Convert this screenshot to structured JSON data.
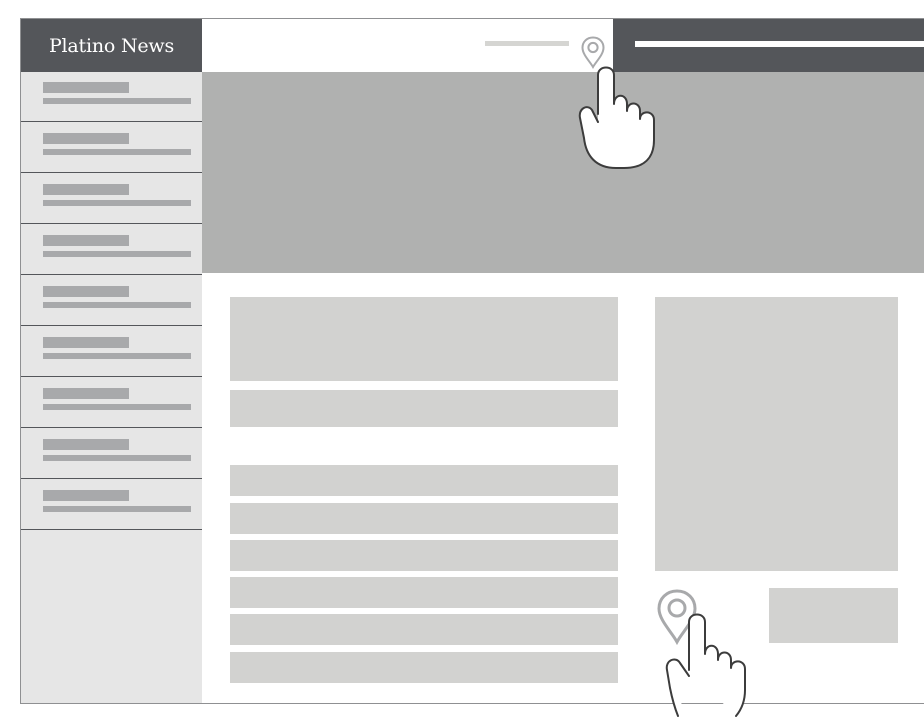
{
  "app": {
    "brand_title": "Platino News"
  },
  "sidebar": {
    "items": [
      {
        "name": "nav-item-1"
      },
      {
        "name": "nav-item-2"
      },
      {
        "name": "nav-item-3"
      },
      {
        "name": "nav-item-4"
      },
      {
        "name": "nav-item-5"
      },
      {
        "name": "nav-item-6"
      },
      {
        "name": "nav-item-7"
      },
      {
        "name": "nav-item-8"
      },
      {
        "name": "nav-item-9"
      }
    ]
  },
  "icons": {
    "location_top": "location-pin-icon",
    "location_bottom": "location-pin-icon",
    "hand_top": "pointing-hand-icon",
    "hand_bottom": "pointing-hand-icon"
  },
  "colors": {
    "brand_bar": "#54565a",
    "sidebar_bg": "#e6e6e6",
    "hero_bg": "#b0b1b0",
    "placeholder": "#d2d2d0",
    "nav_placeholder": "#a8a9ab",
    "pin_stroke": "#a8a9ab",
    "hand_stroke": "#3c3c3c"
  }
}
